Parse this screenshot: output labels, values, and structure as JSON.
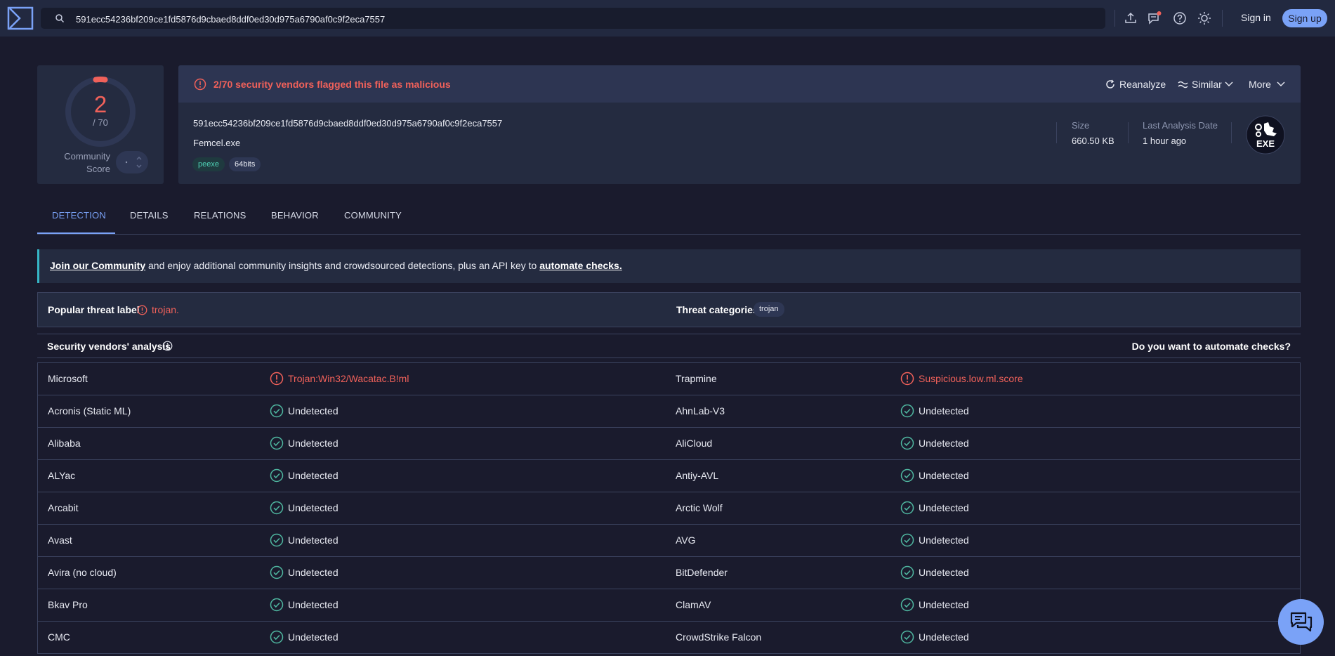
{
  "topbar": {
    "search_value": "591ecc54236bf209ce1fd5876d9cbaed8ddf0ed30d975a6790af0c9f2eca7557",
    "sign_in": "Sign in",
    "sign_up": "Sign up",
    "icons": [
      "logo-icon",
      "search-icon",
      "upload-icon",
      "notifications-icon",
      "help-icon",
      "theme-icon"
    ]
  },
  "score": {
    "detections": "2",
    "total": "/ 70",
    "community_label_1": "Community",
    "community_label_2": "Score"
  },
  "header": {
    "alert": "2/70 security vendors flagged this file as malicious",
    "reanalyze": "Reanalyze",
    "similar": "Similar",
    "more": "More",
    "hash": "591ecc54236bf209ce1fd5876d9cbaed8ddf0ed30d975a6790af0c9f2eca7557",
    "filename": "Femcel.exe",
    "tags": [
      "peexe",
      "64bits"
    ],
    "size_label": "Size",
    "size_value": "660.50 KB",
    "date_label": "Last Analysis Date",
    "date_value": "1 hour ago",
    "filetype": "EXE"
  },
  "tabs": [
    "DETECTION",
    "DETAILS",
    "RELATIONS",
    "BEHAVIOR",
    "COMMUNITY"
  ],
  "banner": {
    "link1": "Join our Community",
    "middle": " and enjoy additional community insights and crowdsourced detections, plus an API key to ",
    "link2": "automate checks."
  },
  "threat": {
    "popular_label": "Popular threat label",
    "popular_value": "trojan.",
    "categories_label": "Threat categories",
    "categories_value": "trojan"
  },
  "vendors_header": {
    "title": "Security vendors' analysis",
    "automate": "Do you want to automate checks?"
  },
  "vendors": [
    {
      "left": {
        "name": "Microsoft",
        "result": "Trojan:Win32/Wacatac.B!ml",
        "status": "malicious"
      },
      "right": {
        "name": "Trapmine",
        "result": "Suspicious.low.ml.score",
        "status": "malicious"
      }
    },
    {
      "left": {
        "name": "Acronis (Static ML)",
        "result": "Undetected",
        "status": "clean"
      },
      "right": {
        "name": "AhnLab-V3",
        "result": "Undetected",
        "status": "clean"
      }
    },
    {
      "left": {
        "name": "Alibaba",
        "result": "Undetected",
        "status": "clean"
      },
      "right": {
        "name": "AliCloud",
        "result": "Undetected",
        "status": "clean"
      }
    },
    {
      "left": {
        "name": "ALYac",
        "result": "Undetected",
        "status": "clean"
      },
      "right": {
        "name": "Antiy-AVL",
        "result": "Undetected",
        "status": "clean"
      }
    },
    {
      "left": {
        "name": "Arcabit",
        "result": "Undetected",
        "status": "clean"
      },
      "right": {
        "name": "Arctic Wolf",
        "result": "Undetected",
        "status": "clean"
      }
    },
    {
      "left": {
        "name": "Avast",
        "result": "Undetected",
        "status": "clean"
      },
      "right": {
        "name": "AVG",
        "result": "Undetected",
        "status": "clean"
      }
    },
    {
      "left": {
        "name": "Avira (no cloud)",
        "result": "Undetected",
        "status": "clean"
      },
      "right": {
        "name": "BitDefender",
        "result": "Undetected",
        "status": "clean"
      }
    },
    {
      "left": {
        "name": "Bkav Pro",
        "result": "Undetected",
        "status": "clean"
      },
      "right": {
        "name": "ClamAV",
        "result": "Undetected",
        "status": "clean"
      }
    },
    {
      "left": {
        "name": "CMC",
        "result": "Undetected",
        "status": "clean"
      },
      "right": {
        "name": "CrowdStrike Falcon",
        "result": "Undetected",
        "status": "clean"
      }
    }
  ],
  "colors": {
    "background": "#1a1b2d",
    "panel": "#242b40",
    "malicious": "#f0615a",
    "clean": "#4fb7a0",
    "accent": "#7aa2f7"
  }
}
